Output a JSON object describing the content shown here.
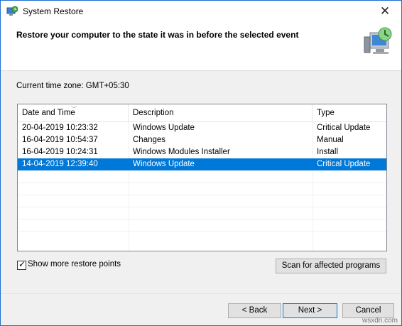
{
  "window": {
    "title": "System Restore"
  },
  "header": {
    "heading": "Restore your computer to the state it was in before the selected event"
  },
  "timezone": {
    "label": "Current time zone: GMT+05:30"
  },
  "list": {
    "columns": [
      "Date and Time",
      "Description",
      "Type"
    ],
    "rows": [
      {
        "date": "20-04-2019 10:23:32",
        "description": "Windows Update",
        "type": "Critical Update"
      },
      {
        "date": "16-04-2019 10:54:37",
        "description": "Changes",
        "type": "Manual"
      },
      {
        "date": "16-04-2019 10:24:31",
        "description": "Windows Modules Installer",
        "type": "Install"
      },
      {
        "date": "14-04-2019 12:39:40",
        "description": "Windows Update",
        "type": "Critical Update"
      }
    ],
    "selected_row": 3
  },
  "options": {
    "show_more_label": "Show more restore points",
    "show_more_checked": true
  },
  "buttons": {
    "scan": "Scan for affected programs",
    "back": "< Back",
    "next": "Next >",
    "cancel": "Cancel"
  },
  "watermark": "wsxdn.com",
  "colors": {
    "selection": "#0078d7",
    "accent_border": "#1f6fd1"
  }
}
